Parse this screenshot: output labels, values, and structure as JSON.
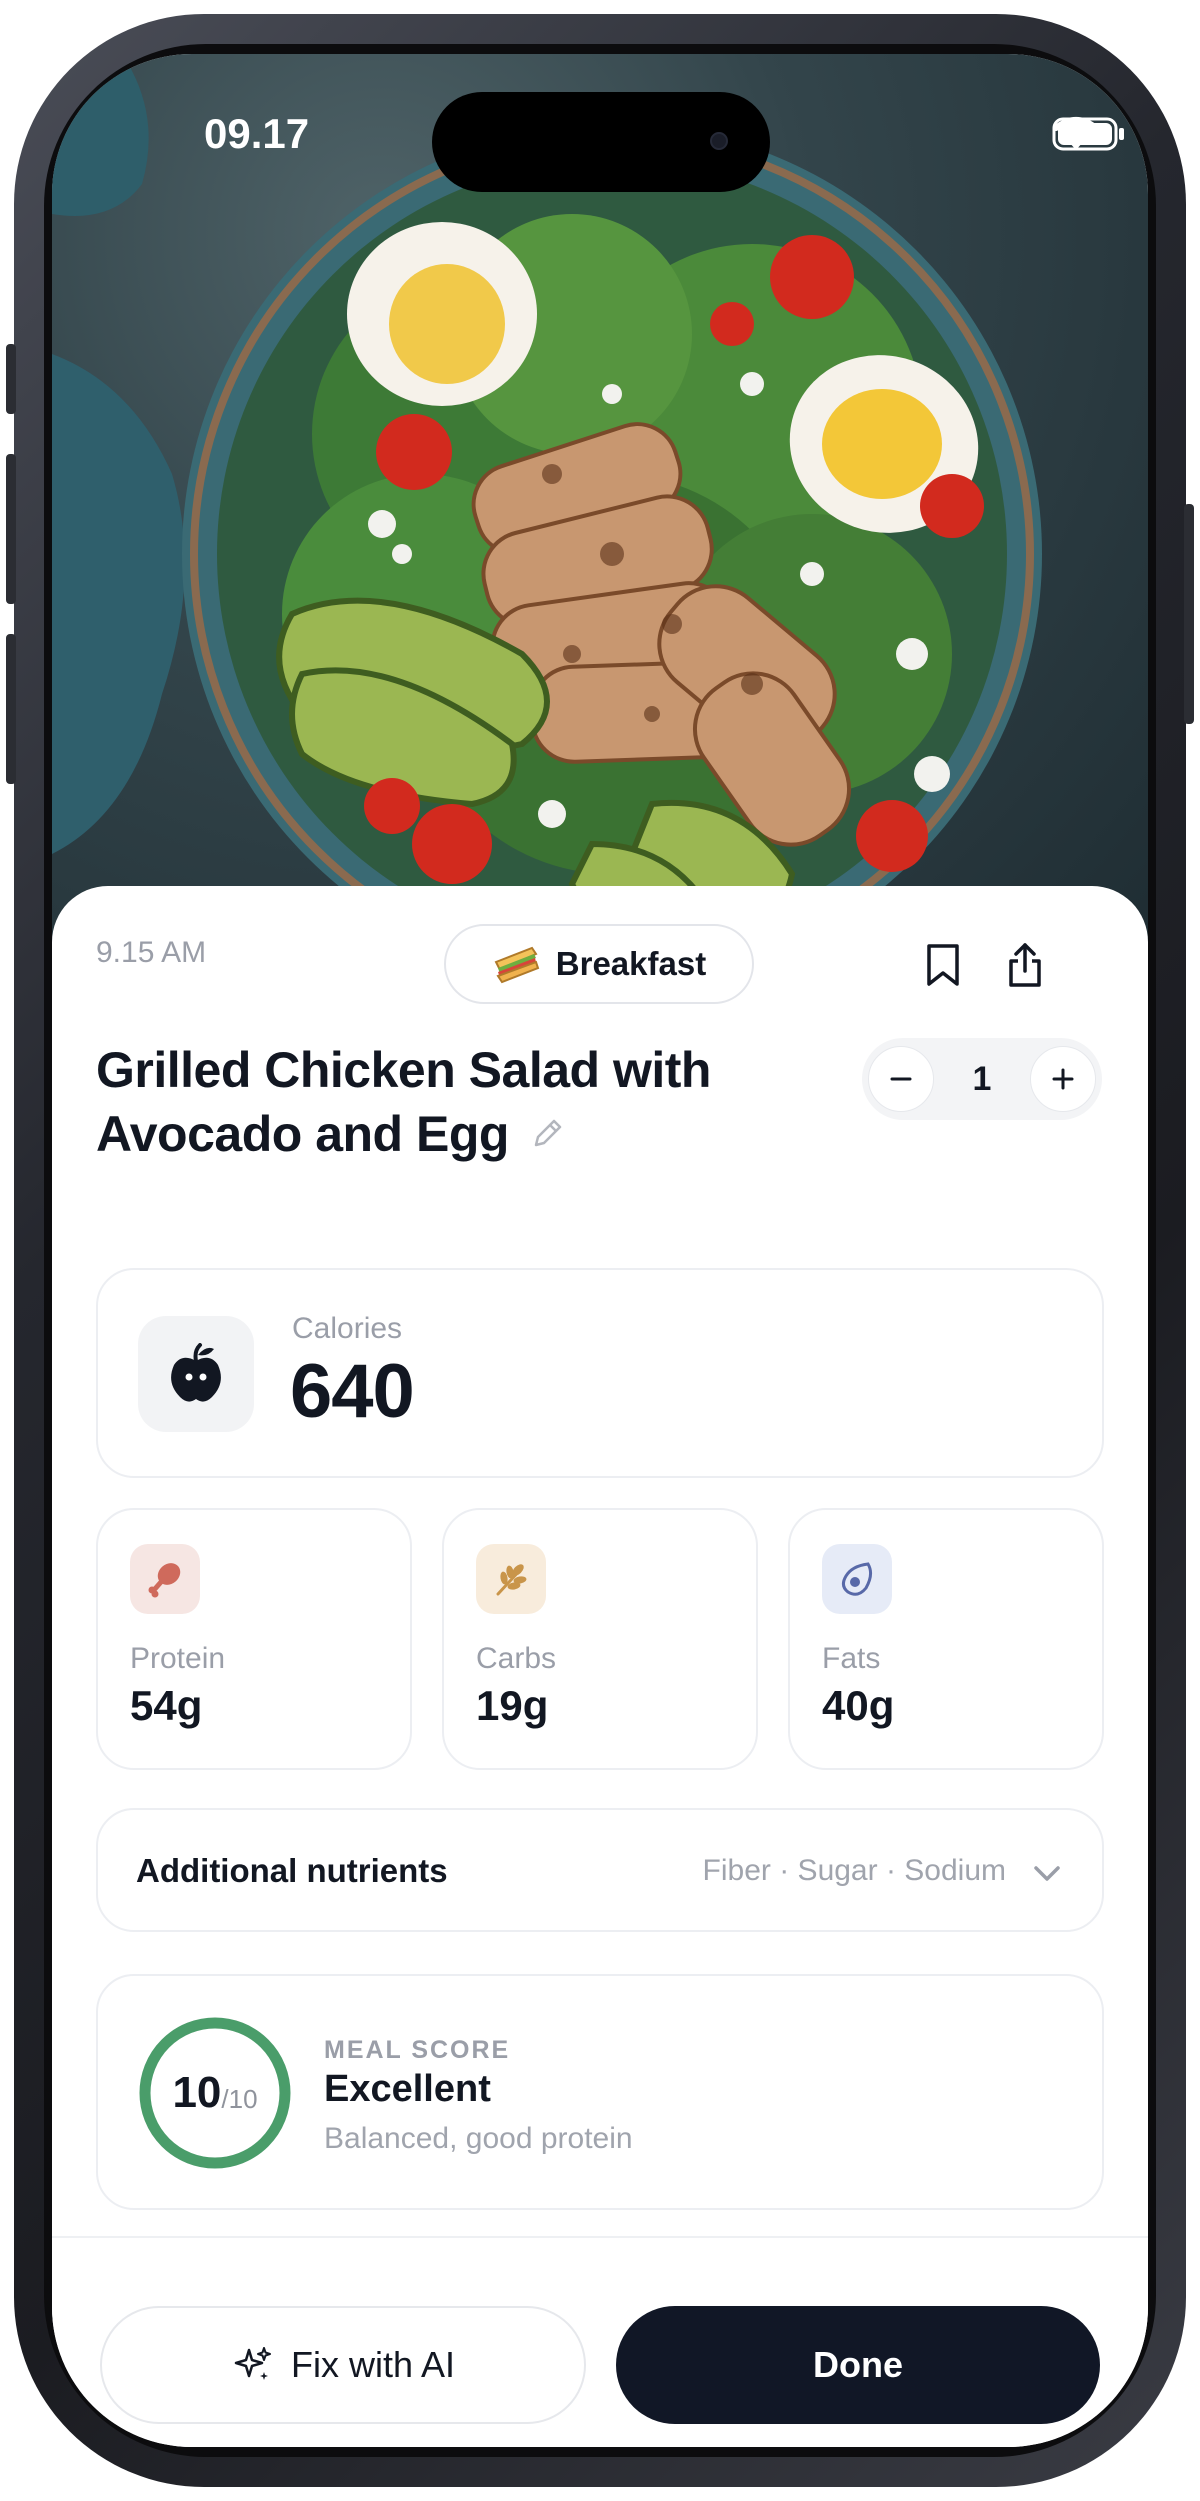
{
  "status_bar": {
    "time": "09.17",
    "icons": [
      "wifi-icon",
      "battery-icon"
    ]
  },
  "hero": {
    "image": "grilled-chicken-salad-photo"
  },
  "meal": {
    "time": "9.15 AM",
    "type_label": "Breakfast",
    "type_icon": "sandwich-emoji",
    "title_line1": "Grilled Chicken Salad with",
    "title_line2": "Avocado and Egg",
    "quantity": "1",
    "actions": [
      "bookmark-icon",
      "share-icon"
    ]
  },
  "calories": {
    "label": "Calories",
    "value": "640"
  },
  "macros": [
    {
      "label": "Protein",
      "value": "54g",
      "icon": "drumstick-icon",
      "color": "#f6e6e3"
    },
    {
      "label": "Carbs",
      "value": "19g",
      "icon": "wheat-icon",
      "color": "#f8ecdc"
    },
    {
      "label": "Fats",
      "value": "40g",
      "icon": "avocado-icon",
      "color": "#e6ebf7"
    }
  ],
  "nutrients": {
    "title": "Additional nutrients",
    "summary": "Fiber · Sugar · Sodium"
  },
  "score": {
    "kicker": "MEAL SCORE",
    "value": "10",
    "max": "/10",
    "fraction": 1.0,
    "rating": "Excellent",
    "description": "Balanced, good protein",
    "ring_color": "#4a9d6a"
  },
  "footer": {
    "fix_label": "Fix with AI",
    "done_label": "Done"
  }
}
